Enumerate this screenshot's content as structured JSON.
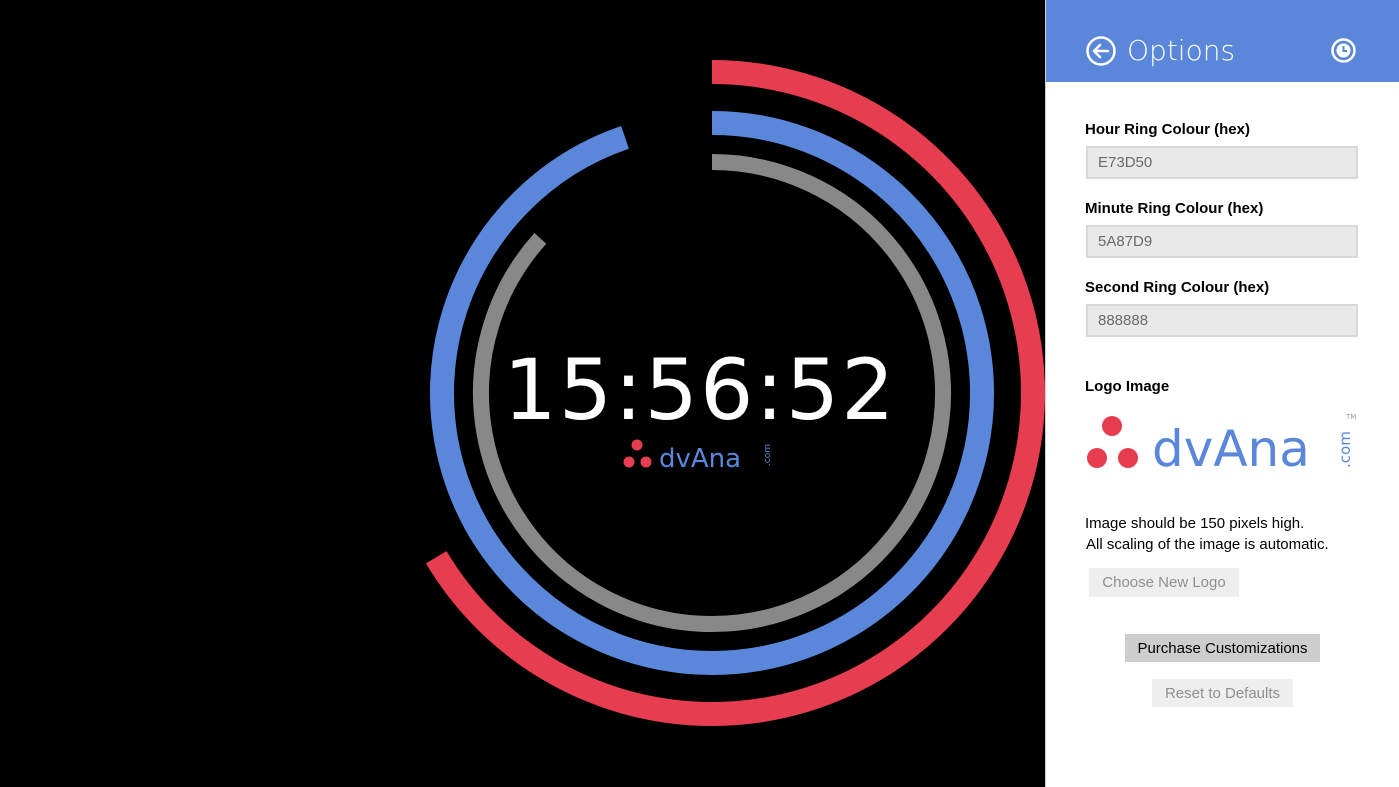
{
  "clock": {
    "time": "15:56:52",
    "hour_ring_color": "#E73D50",
    "minute_ring_color": "#5A87D9",
    "second_ring_color": "#888888",
    "hour_fraction": 0.6645,
    "minute_fraction": 0.9478,
    "second_fraction": 0.8667
  },
  "logo": {
    "text": "dvAna",
    "suffix": ".com",
    "tm": "TM",
    "dot_color": "#E73D50",
    "text_color": "#5A87D9"
  },
  "options": {
    "title": "Options",
    "hour_label": "Hour Ring Colour (hex)",
    "hour_value": "E73D50",
    "minute_label": "Minute Ring Colour (hex)",
    "minute_value": "5A87D9",
    "second_label": "Second Ring Colour (hex)",
    "second_value": "888888",
    "logo_label": "Logo Image",
    "info_line1": "Image should be 150 pixels high.",
    "info_line2": "All scaling of the image is automatic.",
    "choose_logo": "Choose New Logo",
    "purchase": "Purchase Customizations",
    "reset": "Reset to Defaults"
  }
}
